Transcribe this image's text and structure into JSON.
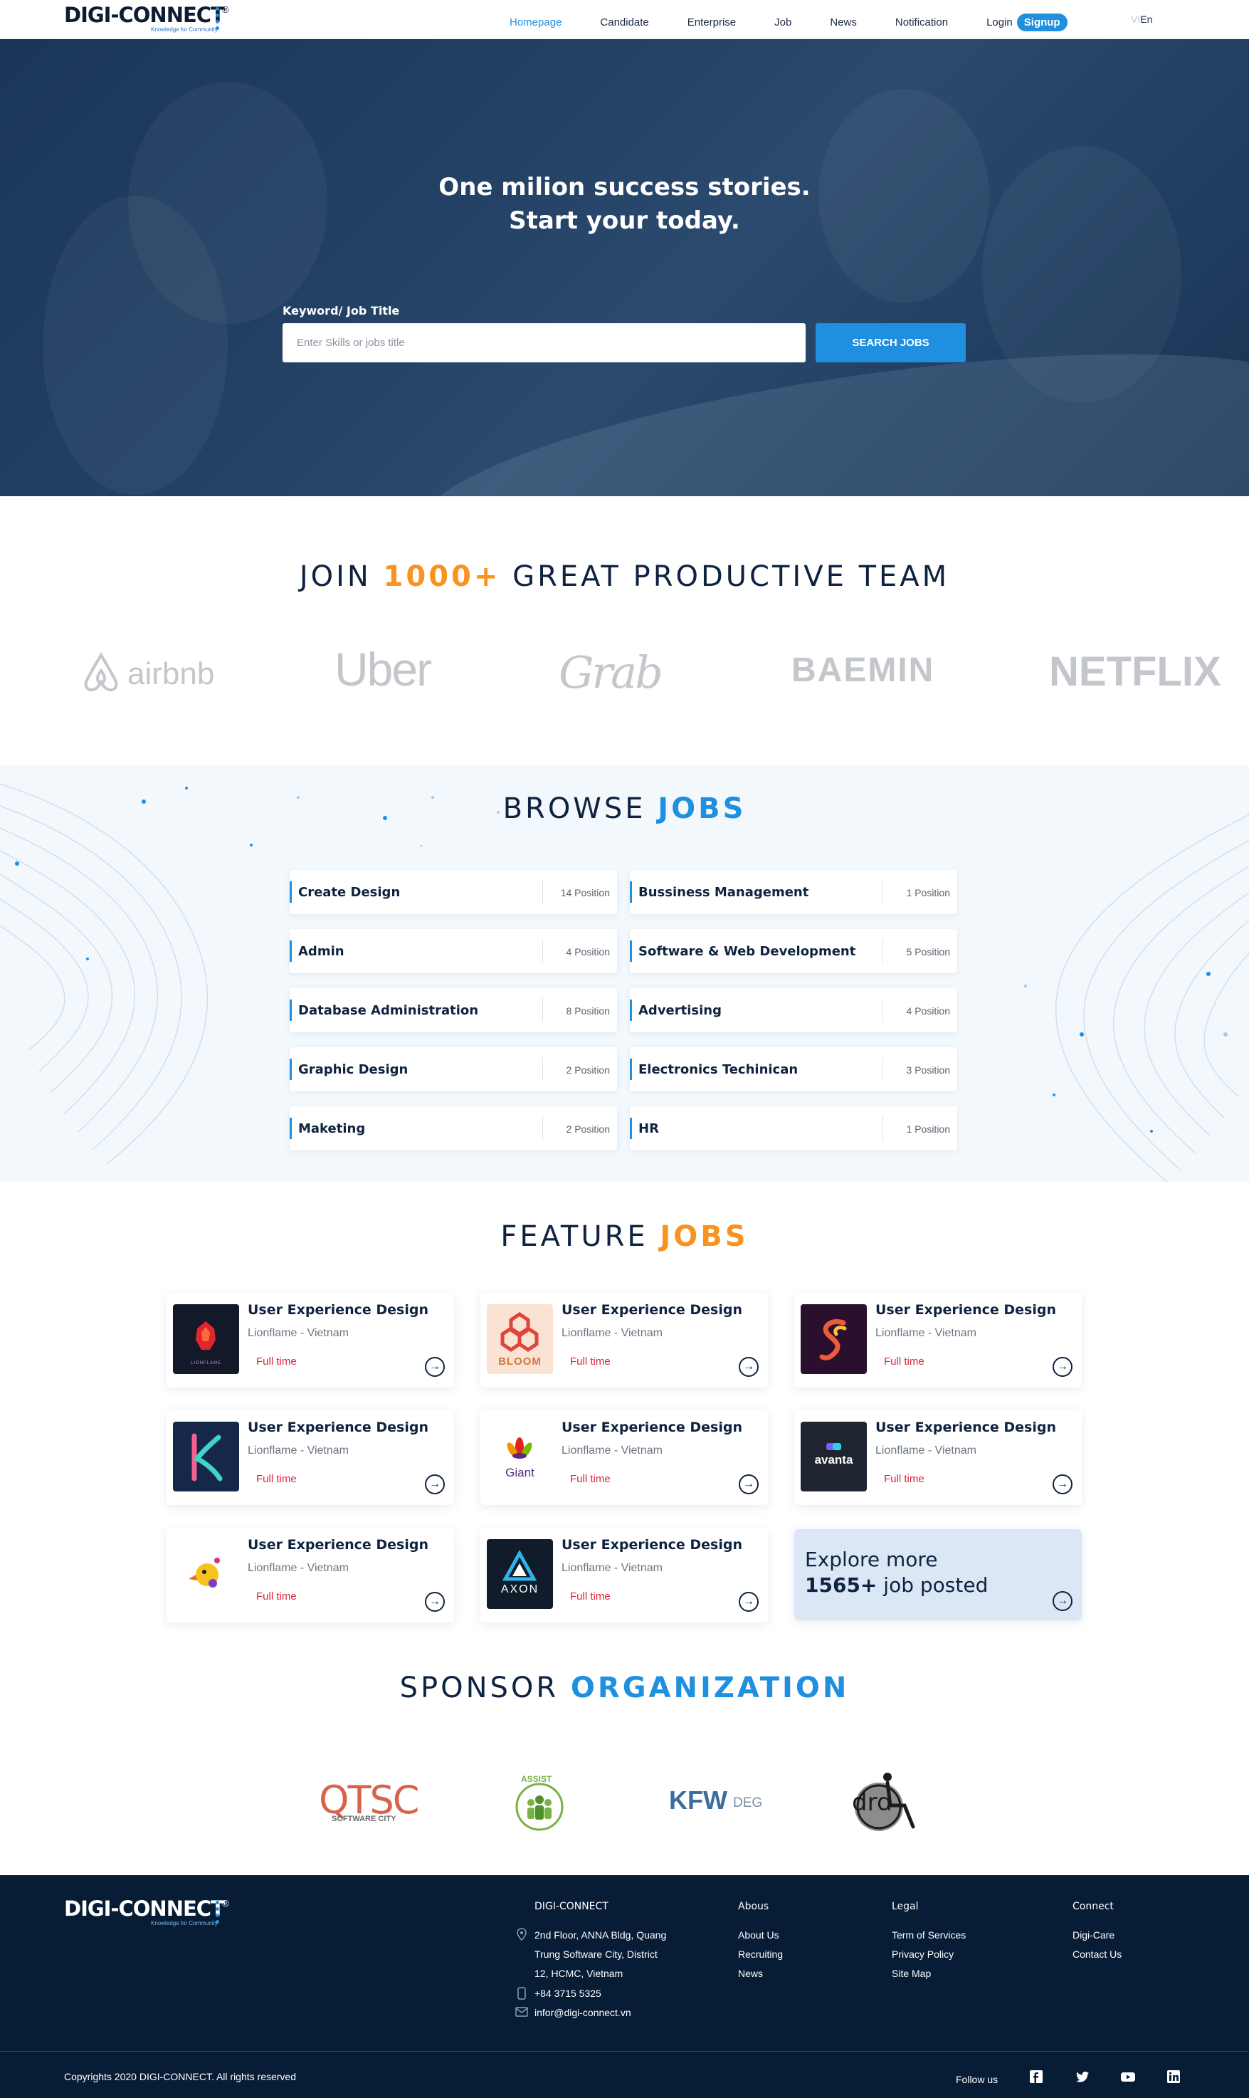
{
  "nav": {
    "logo": "DIGI-CONNECT",
    "logo_tagline": "Knowledge for Community",
    "logo_reg": "®",
    "links": [
      "Homepage",
      "Candidate",
      "Enterprise",
      "Job",
      "News",
      "Notification"
    ],
    "active": "Homepage",
    "login": "Login",
    "signup": "Signup",
    "lang_vi": "VI",
    "lang_en": "En"
  },
  "hero": {
    "title_line1": "One milion success stories.",
    "title_line2": "Start your today.",
    "keyword_label": "Keyword/ Job Title",
    "search_placeholder": "Enter Skills or jobs title",
    "search_button": "SEARCH JOBS"
  },
  "join": {
    "prefix": "JOIN ",
    "highlight": "1000+",
    "suffix": " GREAT PRODUCTIVE TEAM",
    "brands": [
      "airbnb",
      "Uber",
      "Grab",
      "BAEMIN",
      "NETFLIX"
    ]
  },
  "browse": {
    "title_prefix": "BROWSE ",
    "title_highlight": "JOBS",
    "categories": [
      {
        "name": "Create Design",
        "count": "14 Position"
      },
      {
        "name": "Bussiness Management",
        "count": "1 Position"
      },
      {
        "name": "Admin",
        "count": "4 Position"
      },
      {
        "name": "Software & Web Development",
        "count": "5 Position"
      },
      {
        "name": "Database Administration",
        "count": "8 Position"
      },
      {
        "name": "Advertising",
        "count": "4 Position"
      },
      {
        "name": "Graphic Design",
        "count": "2 Position"
      },
      {
        "name": "Electronics Techinican",
        "count": "3 Position"
      },
      {
        "name": "Maketing",
        "count": "2 Position"
      },
      {
        "name": "HR",
        "count": "1 Position"
      }
    ]
  },
  "feature": {
    "title_prefix": "FEATURE ",
    "title_highlight": "JOBS",
    "jobs": [
      {
        "title": "User Experience Design",
        "company": "Lionflame - Vietnam",
        "type": "Full time",
        "logo": "lionflame-logo",
        "logo_text": "LIONFLAME"
      },
      {
        "title": "User Experience Design",
        "company": "Lionflame - Vietnam",
        "type": "Full time",
        "logo": "bloom-logo",
        "logo_text": "BLOOM"
      },
      {
        "title": "User Experience Design",
        "company": "Lionflame - Vietnam",
        "type": "Full time",
        "logo": "s-swirl-logo",
        "logo_text": ""
      },
      {
        "title": "User Experience Design",
        "company": "Lionflame - Vietnam",
        "type": "Full time",
        "logo": "k-logo",
        "logo_text": ""
      },
      {
        "title": "User Experience Design",
        "company": "Lionflame - Vietnam",
        "type": "Full time",
        "logo": "giant-logo",
        "logo_text": "Giant"
      },
      {
        "title": "User Experience Design",
        "company": "Lionflame - Vietnam",
        "type": "Full time",
        "logo": "avanta-logo",
        "logo_text": "avanta"
      },
      {
        "title": "User Experience Design",
        "company": "Lionflame - Vietnam",
        "type": "Full time",
        "logo": "bird-logo",
        "logo_text": ""
      },
      {
        "title": "User Experience Design",
        "company": "Lionflame - Vietnam",
        "type": "Full time",
        "logo": "axon-logo",
        "logo_text": "AXON"
      }
    ],
    "explore_line1": "Explore more",
    "explore_count": "1565+",
    "explore_line2": " job posted"
  },
  "sponsor": {
    "title_prefix": "SPONSOR ",
    "title_highlight": "ORGANIZATION",
    "logos": [
      {
        "name": "qtsc-logo",
        "text": "QTSC",
        "sub": "SOFTWARE CITY"
      },
      {
        "name": "assist-logo",
        "text": "ASSIST"
      },
      {
        "name": "kfw-logo",
        "text": "KFW",
        "sub": "DEG"
      },
      {
        "name": "drd-logo",
        "text": "drd"
      }
    ]
  },
  "footer": {
    "logo": "DIGI-CONNECT",
    "logo_tagline": "Knowledge for Community",
    "logo_reg": "®",
    "company_title": "DIGI-CONNECT",
    "address_line1": "2nd Floor, ANNA Bldg, Quang",
    "address_line2": "Trung Software City, District",
    "address_line3": "12, HCMC, Vietnam",
    "phone": "+84 3715 5325",
    "email": "infor@digi-connect.vn",
    "about_title": "Abous",
    "about_items": [
      "About Us",
      "Recruiting",
      "News"
    ],
    "legal_title": "Legal",
    "legal_items": [
      "Term of Services",
      "Privacy Policy",
      "Site Map"
    ],
    "connect_title": "Connect",
    "connect_items": [
      "Digi-Care",
      "Contact Us"
    ],
    "copyright": "Copyrights 2020 DIGI-CONNECT. All rights reserved",
    "follow": "Follow us",
    "social": [
      "facebook-icon",
      "twitter-icon",
      "youtube-icon",
      "linkedin-icon"
    ]
  },
  "colors": {
    "accent_blue": "#1f8fe0",
    "accent_orange": "#f7931e",
    "navy": "#0f2340",
    "fulltime_red": "#d9263a",
    "footer_bg": "#071d36"
  }
}
